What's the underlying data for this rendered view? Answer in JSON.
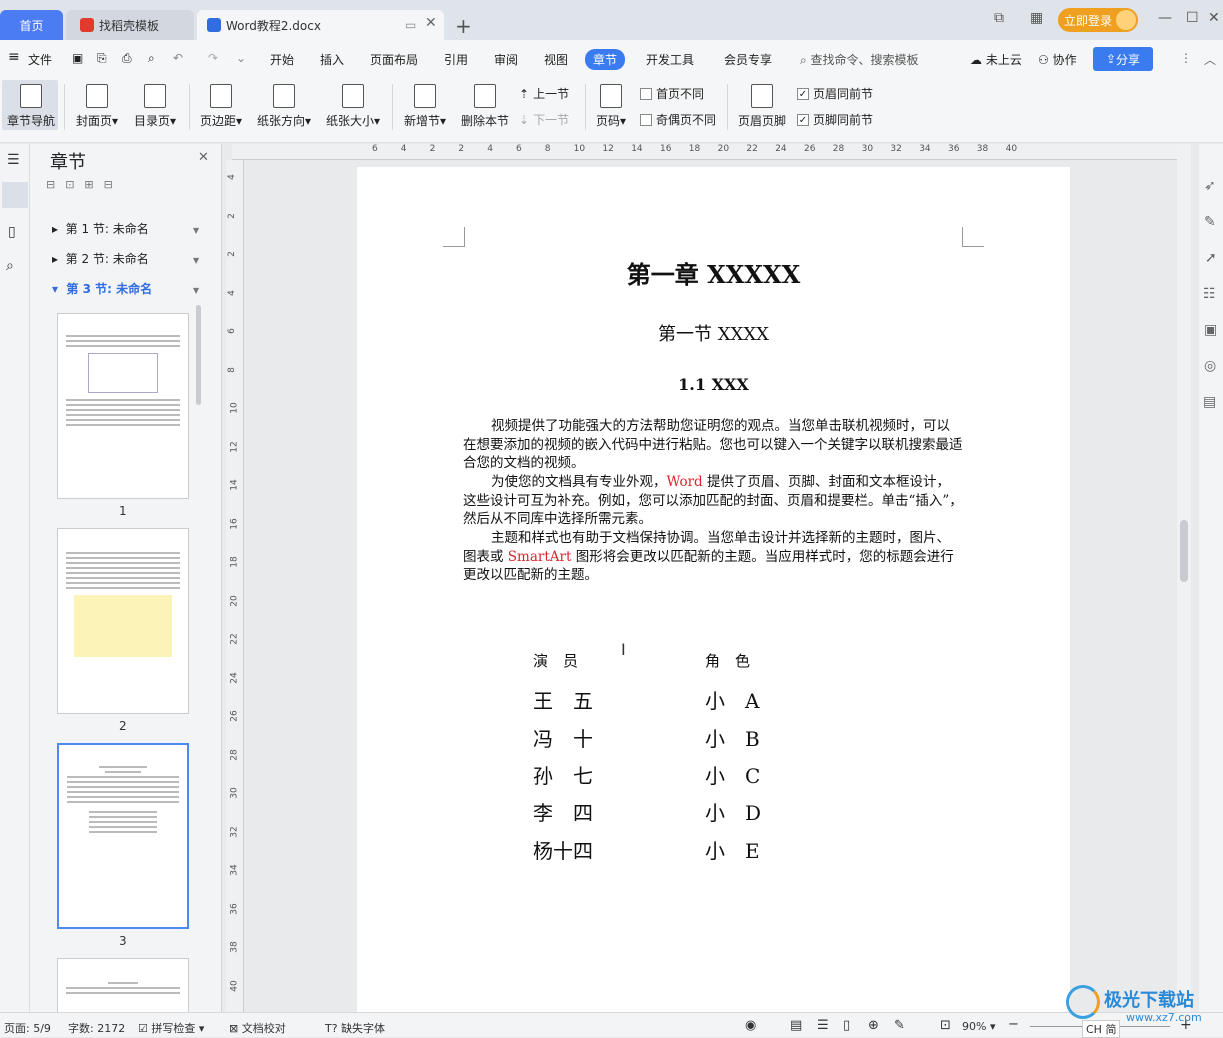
{
  "tabs": {
    "home": "首页",
    "template": "找稻壳模板",
    "document": "Word教程2.docx"
  },
  "login_label": "立即登录",
  "menu": {
    "file": "文件",
    "items": [
      "开始",
      "插入",
      "页面布局",
      "引用",
      "审阅",
      "视图",
      "章节",
      "开发工具",
      "会员专享"
    ],
    "search_placeholder": "查找命令、搜索模板",
    "cloud": "未上云",
    "collab": "协作",
    "share": "分享"
  },
  "ribbon": {
    "nav": "章节导航",
    "cover": "封面页",
    "toc": "目录页",
    "margin": "页边距",
    "orientation": "纸张方向",
    "size": "纸张大小",
    "new_section": "新增节",
    "delete_section": "删除本节",
    "prev_section": "上一节",
    "next_section": "下一节",
    "page_num": "页码",
    "first_page_diff": "首页不同",
    "odd_even_diff": "奇偶页不同",
    "header_footer": "页眉页脚",
    "header_same": "页眉同前节",
    "footer_same": "页脚同前节"
  },
  "navpane": {
    "title": "章节",
    "sections": [
      "第 1 节: 未命名",
      "第 2 节: 未命名",
      "第 3 节: 未命名"
    ],
    "page_numbers": [
      "1",
      "2",
      "3"
    ]
  },
  "ruler_h": [
    "6",
    "4",
    "2",
    "2",
    "4",
    "6",
    "8",
    "10",
    "12",
    "14",
    "16",
    "18",
    "20",
    "22",
    "24",
    "26",
    "28",
    "30",
    "32",
    "34",
    "36",
    "38",
    "40"
  ],
  "ruler_v": [
    "4",
    "2",
    "2",
    "4",
    "6",
    "8",
    "10",
    "12",
    "14",
    "16",
    "18",
    "20",
    "22",
    "24",
    "26",
    "28",
    "30",
    "32",
    "34",
    "36",
    "38",
    "40"
  ],
  "document": {
    "chapter_title": "第一章  XXXXX",
    "section_title": "第一节  XXXX",
    "subsection_title": "1.1 XXX",
    "para1": "视频提供了功能强大的方法帮助您证明您的观点。当您单击联机视频时，可以在想要添加的视频的嵌入代码中进行粘贴。您也可以键入一个关键字以联机搜索最适合您的文档的视频。",
    "para2": "为使您的文档具有专业外观，Word 提供了页眉、页脚、封面和文本框设计，这些设计可互为补充。例如，您可以添加匹配的封面、页眉和提要栏。单击“插入”，然后从不同库中选择所需元素。",
    "para3": "主题和样式也有助于文档保持协调。当您单击设计并选择新的主题时，图片、图表或 SmartArt 图形将会更改以匹配新的主题。当应用样式时，您的标题会进行更改以匹配新的主题。",
    "cast_header": [
      "演　员",
      "角　色"
    ],
    "cast": [
      [
        "王　五",
        "小　A"
      ],
      [
        "冯　十",
        "小　B"
      ],
      [
        "孙　七",
        "小　C"
      ],
      [
        "李　四",
        "小　D"
      ],
      [
        "杨十四",
        "小　E"
      ]
    ]
  },
  "status": {
    "page": "页面: 5/9",
    "words": "字数: 2172",
    "spell": "拼写检查",
    "proof": "文档校对",
    "font_missing": "缺失字体",
    "zoom": "90%",
    "ime": "CH 简"
  },
  "watermark": {
    "name": "极光下载站",
    "url": "www.xz7.com"
  },
  "colors": {
    "accent": "#3b7bf0",
    "login": "#f0a020",
    "red_text": "#d9242a"
  }
}
